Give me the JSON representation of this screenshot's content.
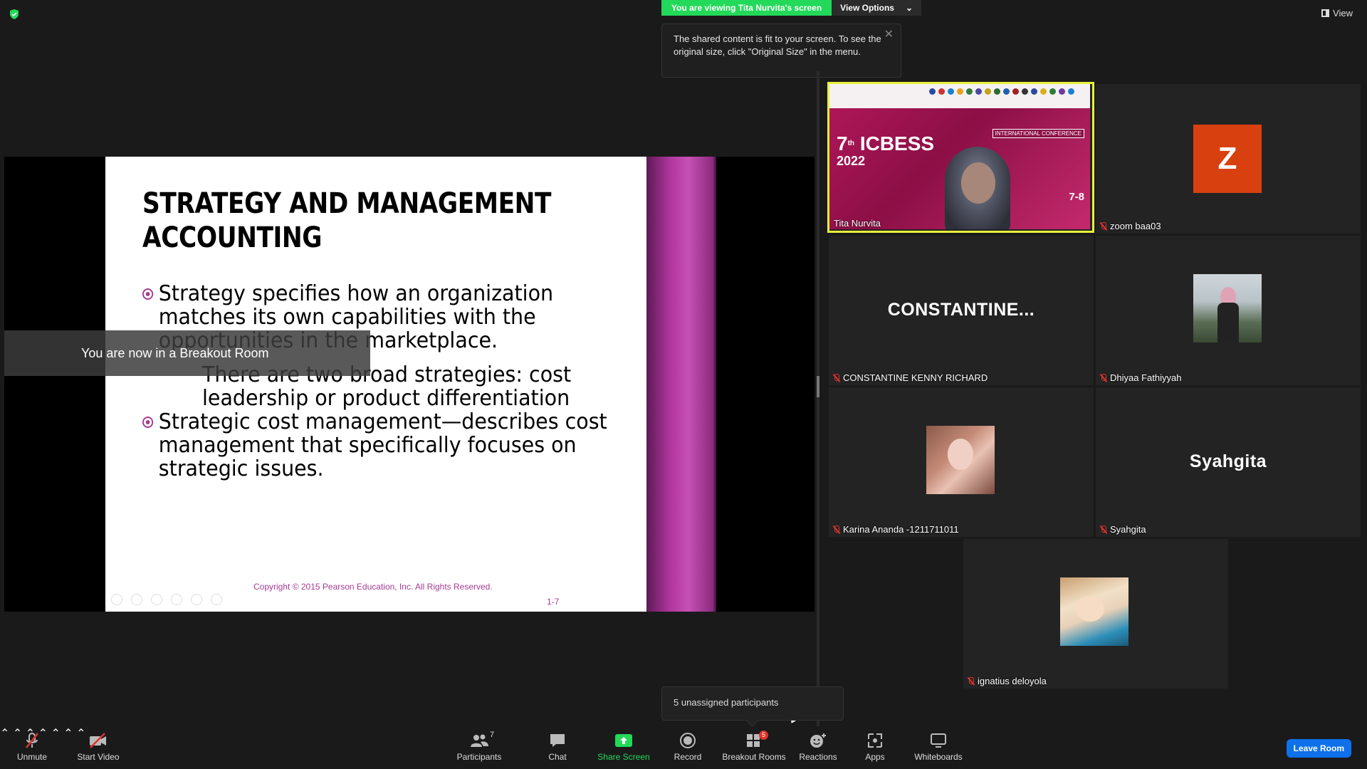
{
  "top": {
    "viewing_banner": "You are viewing Tita Nurvita's screen",
    "view_options": "View Options",
    "view_button": "View",
    "tooltip": "The shared content is fit to your screen. To see the original size, click \"Original Size\" in the menu."
  },
  "slide": {
    "title": "STRATEGY AND MANAGEMENT ACCOUNTING",
    "bullet1": "Strategy specifies how an organization matches its own capabilities with the opportunities in the marketplace.",
    "sub1": "There are two broad strategies:  cost leadership or product differentiation",
    "bullet2": "Strategic cost management—describes cost management that specifically focuses on strategic issues.",
    "copyright": "Copyright © 2015 Pearson Education, Inc. All Rights Reserved.",
    "page": "1-7"
  },
  "breakout_toast": "You are now in a Breakout Room",
  "participants": [
    {
      "name": "Tita Nurvita"
    },
    {
      "name": "zoom baa03",
      "initial": "Z"
    },
    {
      "name": "CONSTANTINE KENNY RICHARD",
      "display": "CONSTANTINE..."
    },
    {
      "name": "Dhiyaa Fathiyyah"
    },
    {
      "name": "Karina Ananda -1211711011"
    },
    {
      "name": "Syahgita",
      "display": "Syahgita"
    },
    {
      "name": "ignatius deloyola"
    }
  ],
  "conference": {
    "number": "7",
    "ordinal": "th",
    "name": "ICBESS",
    "year": "2022",
    "label": "INTERNATIONAL CONFERENCE",
    "date": "7-8"
  },
  "unassigned": "5 unassigned participants",
  "toolbar": {
    "unmute": "Unmute",
    "start_video": "Start Video",
    "participants": "Participants",
    "participants_count": "7",
    "chat": "Chat",
    "share_screen": "Share Screen",
    "record": "Record",
    "breakout_rooms": "Breakout Rooms",
    "breakout_badge": "5",
    "reactions": "Reactions",
    "apps": "Apps",
    "whiteboards": "Whiteboards",
    "leave": "Leave Room"
  },
  "colors": {
    "banner_green": "#23d959",
    "active_speaker": "#e7f23a",
    "leave_blue": "#0e71eb",
    "slide_accent": "#a53b93"
  }
}
